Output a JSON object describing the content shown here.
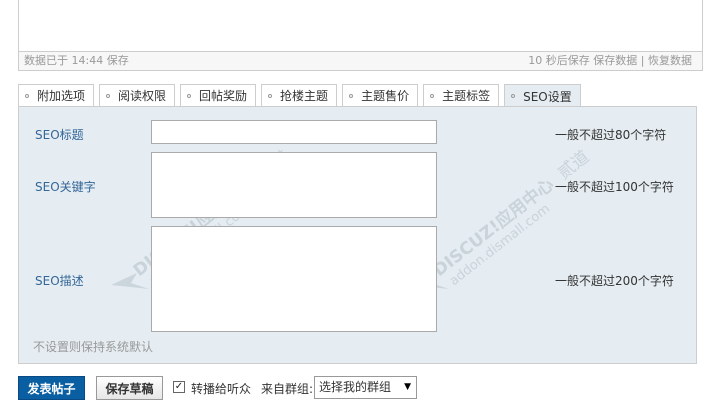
{
  "status_bar": {
    "saved_text": "数据已于 14:44 保存",
    "countdown_text": "10 秒后保存",
    "save_link": "保存数据",
    "separator": "|",
    "restore_link": "恢复数据"
  },
  "tabs": [
    {
      "label": "附加选项",
      "active": false
    },
    {
      "label": "阅读权限",
      "active": false
    },
    {
      "label": "回帖奖励",
      "active": false
    },
    {
      "label": "抢楼主题",
      "active": false
    },
    {
      "label": "主题售价",
      "active": false
    },
    {
      "label": "主题标签",
      "active": false
    },
    {
      "label": "SEO设置",
      "active": true
    }
  ],
  "seo": {
    "title_label": "SEO标题",
    "title_value": "",
    "title_hint": "一般不超过80个字符",
    "keywords_label": "SEO关键字",
    "keywords_value": "",
    "keywords_hint": "一般不超过100个字符",
    "description_label": "SEO描述",
    "description_value": "",
    "description_hint": "一般不超过200个字符",
    "note": "不设置则保持系统默认"
  },
  "watermark": {
    "brand": "DISCUZ!应用中心",
    "site": "addon.dismall.com",
    "author": "贰道"
  },
  "bottom": {
    "publish_button": "发表帖子",
    "draft_button": "保存草稿",
    "broadcast_checked": true,
    "broadcast_label": "转播给听众",
    "group_label": "来自群组:",
    "group_select_value": "选择我的群组"
  },
  "colors": {
    "panel_bg": "#e5edf2",
    "label_blue": "#336699",
    "primary_button": "#0a5ea2"
  },
  "icons": {
    "tab_dot": "circle-bullet-icon",
    "select_arrow": "triangle-down-icon",
    "checkbox_mark": "check-icon"
  }
}
